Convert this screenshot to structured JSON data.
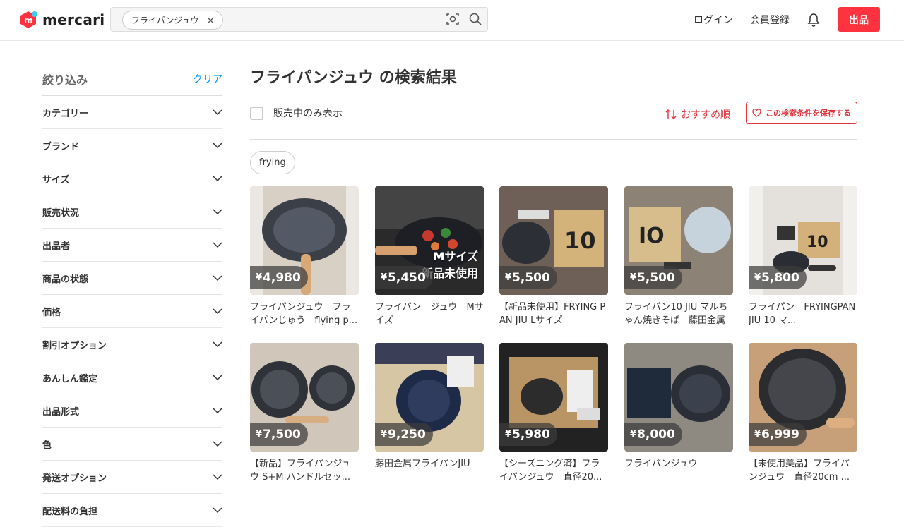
{
  "header": {
    "logo_text": "mercari",
    "search_chip": "フライパンジュウ",
    "login": "ログイン",
    "signup": "会員登録",
    "sell": "出品"
  },
  "sidebar": {
    "title": "絞り込み",
    "clear": "クリア",
    "filters": [
      "カテゴリー",
      "ブランド",
      "サイズ",
      "販売状況",
      "出品者",
      "商品の状態",
      "価格",
      "割引オプション",
      "あんしん鑑定",
      "出品形式",
      "色",
      "発送オプション",
      "配送料の負担"
    ]
  },
  "main": {
    "title": "フライパンジュウ の検索結果",
    "onsale_label": "販売中のみ表示",
    "sort_label": "おすすめ順",
    "save_label": "この検索条件を保存する",
    "tag": "frying",
    "items": [
      {
        "price": "4,980",
        "title": "フライパンジュウ　フライパンじゅう　flying p...",
        "overlay": ""
      },
      {
        "price": "5,450",
        "title": "フライパン　ジュウ　Mサイズ",
        "overlay": "Mサイズ\n新品未使用"
      },
      {
        "price": "5,500",
        "title": "【新品未使用】FRYING PAN JIU Lサイズ",
        "overlay": ""
      },
      {
        "price": "5,500",
        "title": "フライパン10 JIU マルちゃん焼きそば　藤田金属",
        "overlay": ""
      },
      {
        "price": "5,800",
        "title": "フライパン　FRYINGPAN JIU 10 マ...",
        "overlay": ""
      },
      {
        "price": "7,500",
        "title": "【新品】フライパンジュウ S+M ハンドルセッ...",
        "overlay": ""
      },
      {
        "price": "9,250",
        "title": "藤田金属フライパンJIU",
        "overlay": ""
      },
      {
        "price": "5,980",
        "title": "【シーズニング済】フライパンジュウ　直径20...",
        "overlay": ""
      },
      {
        "price": "8,000",
        "title": "フライパンジュウ",
        "overlay": ""
      },
      {
        "price": "6,999",
        "title": "【未使用美品】フライパンジュウ　直径20cm ...",
        "overlay": ""
      }
    ]
  },
  "colors": {
    "brand": "#ff333f",
    "accent": "#e0343d",
    "link": "#0095ee"
  },
  "icons": [
    "camera-search-icon",
    "search-icon",
    "bell-icon",
    "chevron-down-icon",
    "sort-icon",
    "heart-icon",
    "close-icon"
  ]
}
